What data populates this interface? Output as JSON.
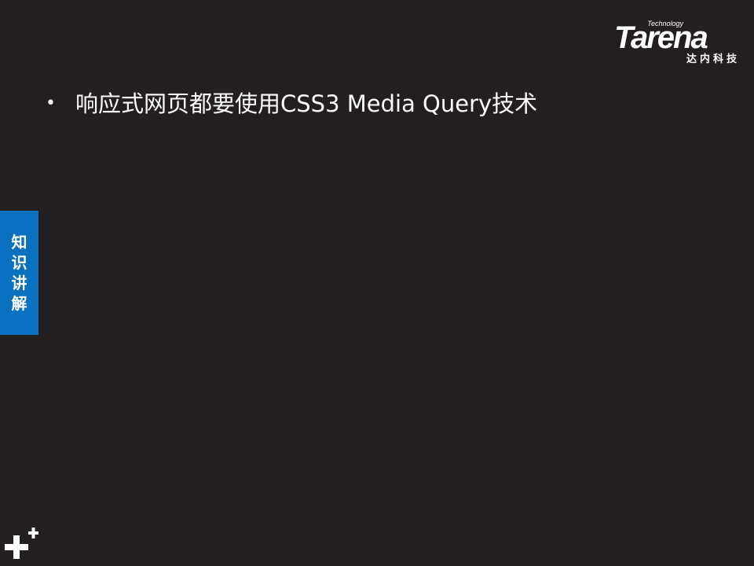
{
  "logo": {
    "tech": "Technology",
    "word": "Tarena",
    "cn": "达内科技"
  },
  "content": {
    "bullet_text": "响应式网页都要使用CSS3 Media Query技术"
  },
  "side_tab": {
    "chars": [
      "知",
      "识",
      "讲",
      "解"
    ]
  },
  "colors": {
    "background": "#231f20",
    "side_tab": "#0a70c0",
    "text": "#ffffff"
  }
}
